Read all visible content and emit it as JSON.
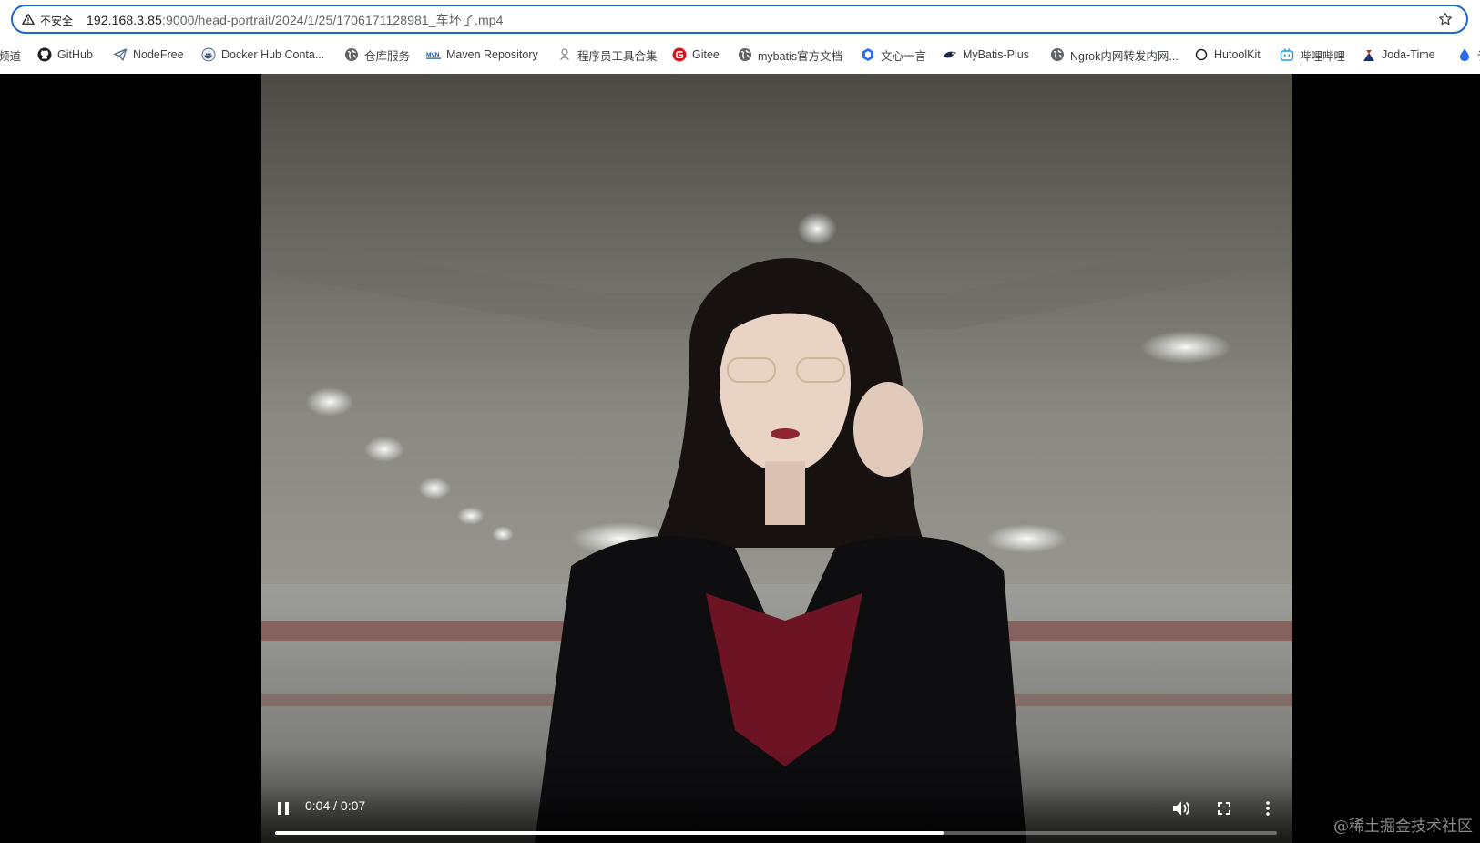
{
  "address_bar": {
    "security_label": "不安全",
    "url_host": "192.168.3.85",
    "url_path": ":9000/head-portrait/2024/1/25/1706171128981_车坏了.mp4"
  },
  "bookmarks": [
    {
      "label": "频道",
      "icon": "partial-icon"
    },
    {
      "label": "GitHub",
      "icon": "github-icon"
    },
    {
      "label": "NodeFree",
      "icon": "paper-plane-icon"
    },
    {
      "label": "Docker Hub Conta...",
      "icon": "docker-icon"
    },
    {
      "label": "仓库服务",
      "icon": "globe-icon"
    },
    {
      "label": "Maven Repository",
      "icon": "maven-icon"
    },
    {
      "label": "程序员工具合集",
      "icon": "tools-icon"
    },
    {
      "label": "Gitee",
      "icon": "gitee-icon"
    },
    {
      "label": "mybatis官方文档",
      "icon": "globe-icon"
    },
    {
      "label": "文心一言",
      "icon": "wenxin-icon"
    },
    {
      "label": "MyBatis-Plus",
      "icon": "mybatis-plus-icon"
    },
    {
      "label": "Ngrok内网转发内网...",
      "icon": "globe-icon"
    },
    {
      "label": "HutoolKit",
      "icon": "circle-icon"
    },
    {
      "label": "哔哩哔哩",
      "icon": "bilibili-icon"
    },
    {
      "label": "Joda-Time",
      "icon": "joda-icon"
    },
    {
      "label": "讠",
      "icon": "drop-icon"
    }
  ],
  "video": {
    "current_time": "0:04",
    "duration": "0:07",
    "progress_fraction": 0.667
  },
  "watermark": "@稀土掘金技术社区",
  "colors": {
    "focus_ring": "#1a66c9",
    "video_bg": "#000000"
  }
}
